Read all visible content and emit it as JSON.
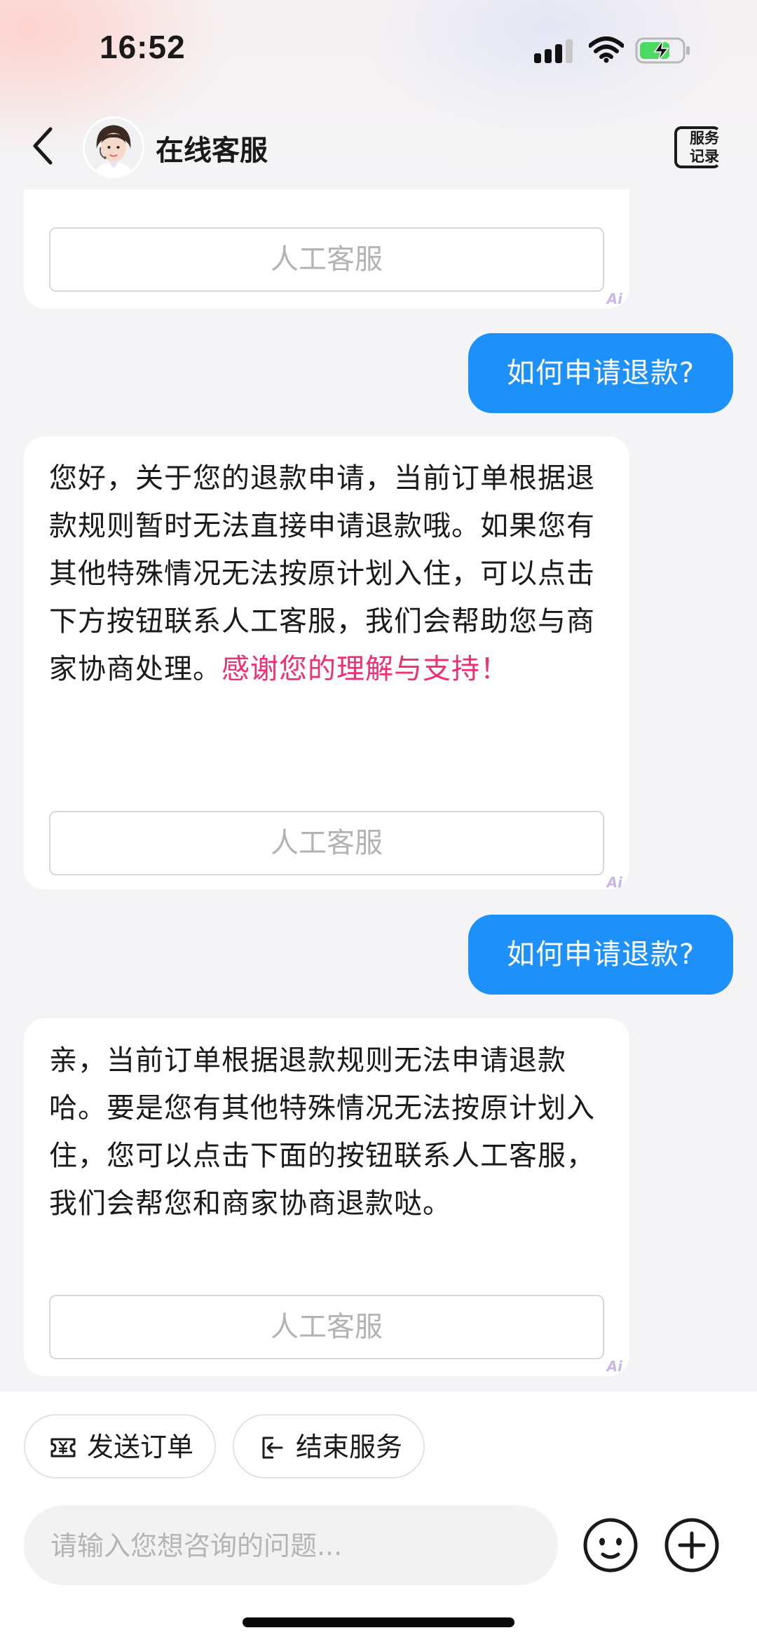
{
  "status_bar": {
    "time": "16:52"
  },
  "header": {
    "title": "在线客服",
    "service_record_label": "服务记录"
  },
  "messages": [
    {
      "role": "bot",
      "text": "",
      "highlight": "",
      "button_label": "人工客服",
      "ai_tag": "Ai"
    },
    {
      "role": "user",
      "text": "如何申请退款?"
    },
    {
      "role": "bot",
      "text": "您好，关于您的退款申请，当前订单根据退款规则暂时无法直接申请退款哦。如果您有其他特殊情况无法按原计划入住，可以点击下方按钮联系人工客服，我们会帮助您与商家协商处理。",
      "highlight": "感谢您的理解与支持！",
      "button_label": "人工客服",
      "ai_tag": "Ai"
    },
    {
      "role": "user",
      "text": "如何申请退款?"
    },
    {
      "role": "bot",
      "text": "亲，当前订单根据退款规则无法申请退款哈。要是您有其他特殊情况无法按原计划入住，您可以点击下面的按钮联系人工客服，我们会帮您和商家协商退款哒。",
      "highlight": "",
      "button_label": "人工客服",
      "ai_tag": "Ai"
    }
  ],
  "quick_actions": [
    {
      "label": "发送订单",
      "icon": "order-ticket-icon"
    },
    {
      "label": "结束服务",
      "icon": "exit-service-icon"
    }
  ],
  "composer": {
    "placeholder": "请输入您想咨询的问题..."
  },
  "colors": {
    "user_bubble": "#1e90fa",
    "highlight_text": "#ee2f74",
    "page_background": "#f4f4f6"
  }
}
